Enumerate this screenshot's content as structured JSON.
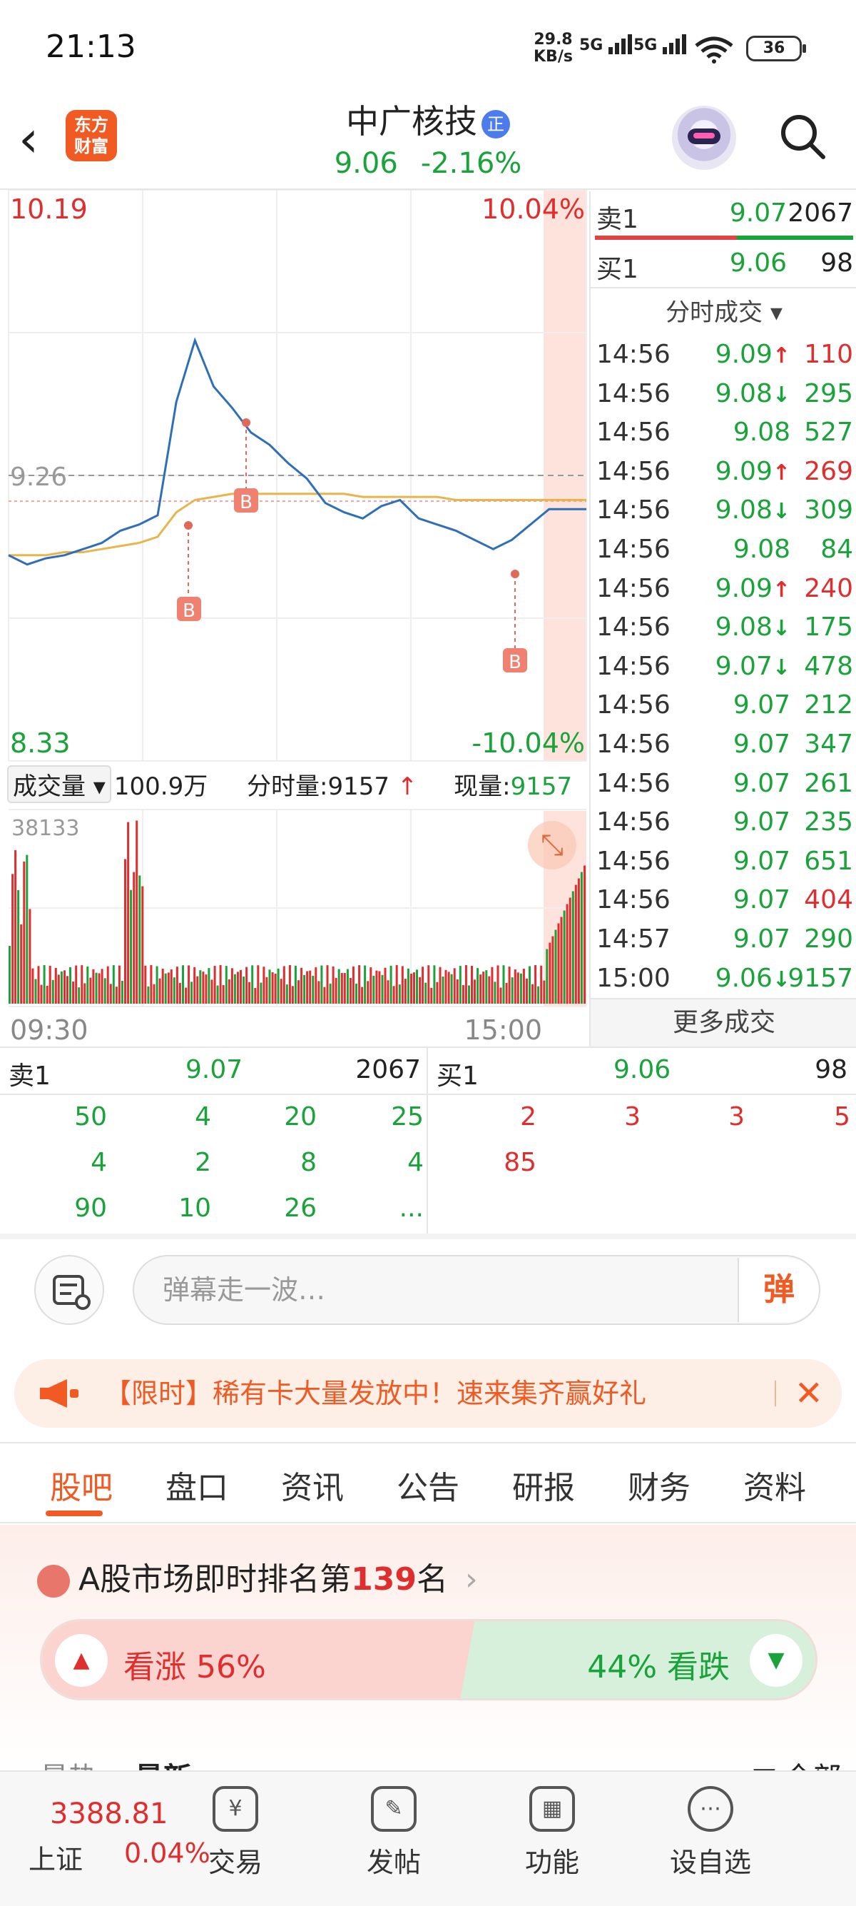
{
  "status_bar": {
    "time": "21:13",
    "net_speed": "29.8",
    "net_unit": "KB/s",
    "sig1": "5G",
    "sig2": "5G",
    "battery": "36"
  },
  "header": {
    "logo_line1": "东方",
    "logo_line2": "财富",
    "stock_name": "中广核技",
    "badge": "正",
    "price": "9.06",
    "change_pct": "-2.16%"
  },
  "chart": {
    "max_price": "10.19",
    "max_pct": "10.04%",
    "min_price": "8.33",
    "min_pct": "-10.04%",
    "ref_price": "9.26",
    "marker": "B",
    "vol_selector": "成交量",
    "total_vol": "100.9万",
    "fenshi_label": "分时量:",
    "fenshi_value": "9157",
    "xianliang_label": "现量:",
    "xianliang_value": "9157",
    "vol_max": "38133",
    "time_start": "09:30",
    "time_end": "15:00"
  },
  "chart_data": {
    "type": "line",
    "x_range": [
      "09:30",
      "15:00"
    ],
    "ylim": [
      8.33,
      10.19
    ],
    "ref_line": 9.26,
    "series": [
      {
        "values": [
          9.0,
          8.97,
          8.99,
          9.0,
          9.02,
          9.04,
          9.08,
          9.1,
          9.13,
          9.5,
          9.7,
          9.55,
          9.48,
          9.4,
          9.36,
          9.3,
          9.25,
          9.17,
          9.14,
          9.12,
          9.16,
          9.18,
          9.12,
          9.1,
          9.08,
          9.05,
          9.02,
          9.05,
          9.1,
          9.15,
          9.15,
          9.15
        ]
      },
      {
        "values": [
          9.0,
          9.0,
          9.0,
          9.01,
          9.01,
          9.02,
          9.03,
          9.04,
          9.06,
          9.14,
          9.18,
          9.19,
          9.2,
          9.2,
          9.2,
          9.2,
          9.2,
          9.2,
          9.2,
          9.19,
          9.19,
          9.19,
          9.19,
          9.19,
          9.18,
          9.18,
          9.18,
          9.18,
          9.18,
          9.18,
          9.18,
          9.18
        ]
      }
    ],
    "volume_max": 38133
  },
  "order_book": {
    "sell1_label": "卖1",
    "sell1_price": "9.07",
    "sell1_vol": "2067",
    "buy1_label": "买1",
    "buy1_price": "9.06",
    "buy1_vol": "98",
    "sell_ratio": 0.55
  },
  "ticks": {
    "title": "分时成交",
    "rows": [
      {
        "time": "14:56",
        "price": "9.09",
        "arrow": "↑",
        "vol": "110",
        "dir": "up"
      },
      {
        "time": "14:56",
        "price": "9.08",
        "arrow": "↓",
        "vol": "295",
        "dir": "down"
      },
      {
        "time": "14:56",
        "price": "9.08",
        "arrow": "",
        "vol": "527",
        "dir": "down"
      },
      {
        "time": "14:56",
        "price": "9.09",
        "arrow": "↑",
        "vol": "269",
        "dir": "up"
      },
      {
        "time": "14:56",
        "price": "9.08",
        "arrow": "↓",
        "vol": "309",
        "dir": "down"
      },
      {
        "time": "14:56",
        "price": "9.08",
        "arrow": "",
        "vol": "84",
        "dir": "down"
      },
      {
        "time": "14:56",
        "price": "9.09",
        "arrow": "↑",
        "vol": "240",
        "dir": "up"
      },
      {
        "time": "14:56",
        "price": "9.08",
        "arrow": "↓",
        "vol": "175",
        "dir": "down"
      },
      {
        "time": "14:56",
        "price": "9.07",
        "arrow": "↓",
        "vol": "478",
        "dir": "down"
      },
      {
        "time": "14:56",
        "price": "9.07",
        "arrow": "",
        "vol": "212",
        "dir": "down"
      },
      {
        "time": "14:56",
        "price": "9.07",
        "arrow": "",
        "vol": "347",
        "dir": "down"
      },
      {
        "time": "14:56",
        "price": "9.07",
        "arrow": "",
        "vol": "261",
        "dir": "down"
      },
      {
        "time": "14:56",
        "price": "9.07",
        "arrow": "",
        "vol": "235",
        "dir": "down"
      },
      {
        "time": "14:56",
        "price": "9.07",
        "arrow": "",
        "vol": "651",
        "dir": "down"
      },
      {
        "time": "14:56",
        "price": "9.07",
        "arrow": "",
        "vol": "404",
        "dir": "up"
      },
      {
        "time": "14:57",
        "price": "9.07",
        "arrow": "",
        "vol": "290",
        "dir": "down"
      },
      {
        "time": "15:00",
        "price": "9.06",
        "arrow": "↓",
        "vol": "9157",
        "dir": "down"
      }
    ],
    "more": "更多成交"
  },
  "queue": {
    "sell_label": "卖1",
    "sell_price": "9.07",
    "sell_total": "2067",
    "buy_label": "买1",
    "buy_price": "9.06",
    "buy_total": "98",
    "sell_cells": [
      "50",
      "4",
      "20",
      "25",
      "4",
      "2",
      "8",
      "4",
      "90",
      "10",
      "26",
      "..."
    ],
    "buy_cells": [
      "2",
      "3",
      "3",
      "5",
      "85"
    ]
  },
  "danmu": {
    "placeholder": "弹幕走一波…",
    "button": "弹"
  },
  "banner": {
    "text": "【限时】稀有卡大量发放中！速来集齐赢好礼",
    "close": "✕"
  },
  "tabs": [
    "股吧",
    "盘口",
    "资讯",
    "公告",
    "研报",
    "财务",
    "资料"
  ],
  "rank": {
    "prefix": "A股市场即时排名第",
    "rank": "139",
    "suffix": "名",
    "chevron": "›"
  },
  "vote": {
    "up_label": "看涨 56%",
    "down_label": "44% 看跌",
    "up_ratio": 0.56
  },
  "partial_row": {
    "left1": "最热",
    "left2": "最新",
    "right": "全部"
  },
  "bottom_nav": {
    "index_value": "3388.81",
    "index_name": "上证",
    "index_pct": "0.04%",
    "items": [
      {
        "label": "交易",
        "icon": "¥"
      },
      {
        "label": "发帖",
        "icon": "✎"
      },
      {
        "label": "功能",
        "icon": "▦"
      },
      {
        "label": "设自选",
        "icon": "⋯"
      }
    ]
  }
}
